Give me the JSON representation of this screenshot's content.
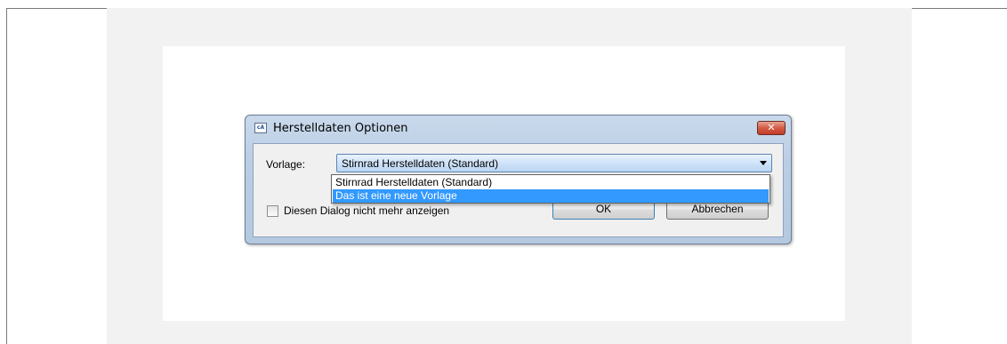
{
  "dialog": {
    "title": "Herstelldaten Optionen",
    "app_icon_text": "cA",
    "close_symbol": "✕",
    "vorlage_label": "Vorlage:",
    "vorlage_selected": "Stirnrad Herstelldaten (Standard)",
    "dropdown_options": [
      "Stirnrad Herstelldaten (Standard)",
      "Das ist eine neue Vorlage"
    ],
    "checkbox_label": "Diesen Dialog nicht mehr anzeigen",
    "ok_label": "OK",
    "cancel_label": "Abbrechen"
  },
  "colors": {
    "highlight": "#3399ff",
    "close_button": "#c23d29",
    "titlebar": "#b9cde4"
  },
  "icons": {
    "app": "application-icon",
    "close": "close-icon",
    "dropdown": "chevron-down-icon"
  }
}
